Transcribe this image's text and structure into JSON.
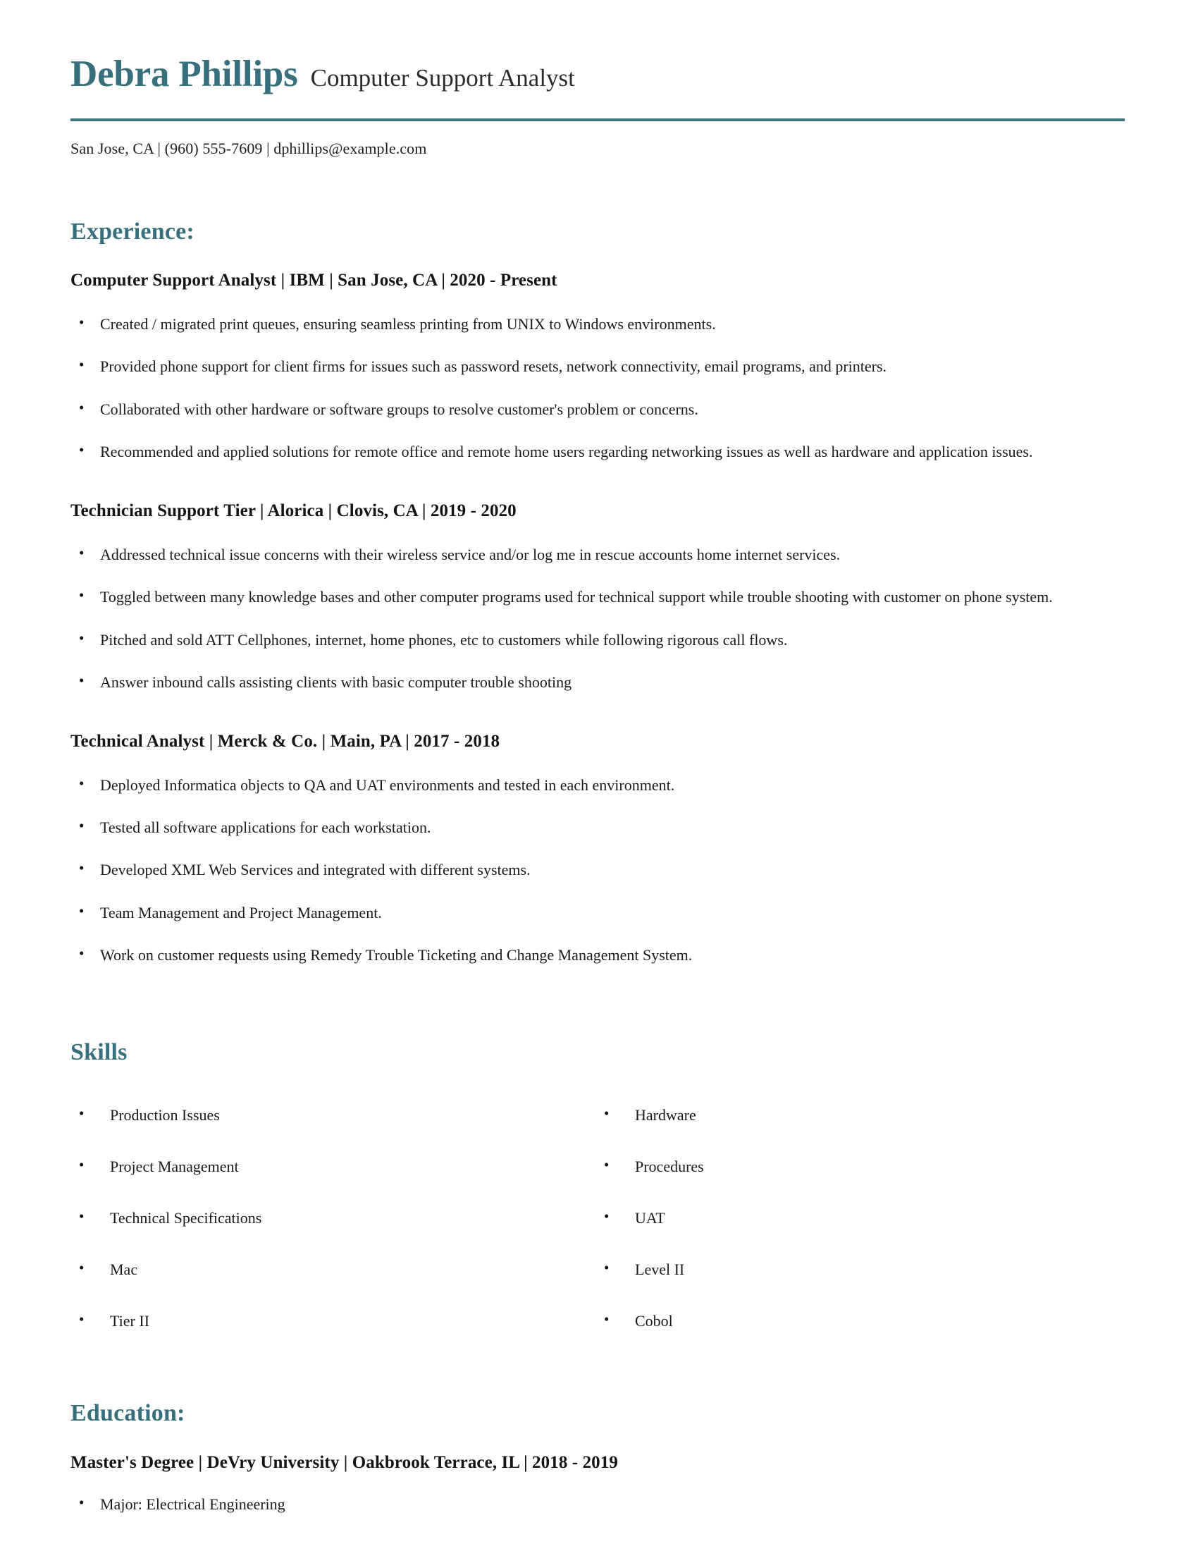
{
  "theme": {
    "accent_color": "#37707C",
    "rule_color": "#3D7480",
    "text_color": "#1B1B1B"
  },
  "header": {
    "name": "Debra Phillips",
    "job_title": "Computer Support Analyst",
    "contact": "San Jose, CA  |  (960) 555-7609  |  dphillips@example.com",
    "location": "San Jose, CA",
    "phone": "(960) 555-7609",
    "email": "dphillips@example.com"
  },
  "experience": {
    "heading": "Experience:",
    "entries": [
      {
        "heading": "Computer Support Analyst | IBM | San Jose, CA | 2020 - Present",
        "title": "Computer Support Analyst",
        "company": "IBM",
        "location": "San Jose, CA",
        "dates": "2020 - Present",
        "bullets": [
          "Created / migrated print queues, ensuring seamless printing from UNIX to Windows environments.",
          "Provided phone support for client firms for issues such as password resets, network connectivity, email programs, and printers.",
          "Collaborated with other hardware or software groups to resolve customer's problem or concerns.",
          "Recommended and applied solutions for remote office and remote home users regarding networking issues as well as hardware and application issues."
        ]
      },
      {
        "heading": "Technician Support Tier | Alorica | Clovis, CA | 2019 - 2020",
        "title": "Technician Support Tier",
        "company": "Alorica",
        "location": "Clovis, CA",
        "dates": "2019 - 2020",
        "bullets": [
          "Addressed technical issue concerns with their wireless service and/or log me in rescue accounts home internet services.",
          "Toggled between many knowledge bases and other computer programs used for technical support while trouble shooting with customer on phone system.",
          "Pitched and sold ATT Cellphones, internet, home phones, etc to customers while following rigorous call flows.",
          "Answer inbound calls assisting clients with basic computer trouble shooting"
        ]
      },
      {
        "heading": "Technical Analyst | Merck & Co. | Main, PA | 2017 - 2018",
        "title": "Technical Analyst",
        "company": "Merck & Co.",
        "location": "Main, PA",
        "dates": "2017 - 2018",
        "bullets": [
          "Deployed Informatica objects to QA and UAT environments and tested in each environment.",
          "Tested all software applications for each workstation.",
          "Developed XML Web Services and integrated with different systems.",
          "Team Management and Project Management.",
          "Work on customer requests using Remedy Trouble Ticketing and Change Management System."
        ]
      }
    ]
  },
  "skills": {
    "heading": "Skills",
    "column_left": [
      "Production Issues",
      "Project Management",
      "Technical Specifications",
      "Mac",
      "Tier II"
    ],
    "column_right": [
      "Hardware",
      "Procedures",
      "UAT",
      "Level II",
      "Cobol"
    ]
  },
  "education": {
    "heading": "Education:",
    "entries": [
      {
        "heading": "Master's Degree | DeVry University | Oakbrook Terrace, IL | 2018 - 2019",
        "degree": "Master's Degree",
        "school": "DeVry University",
        "location": "Oakbrook Terrace, IL",
        "dates": "2018 - 2019",
        "bullets": [
          "Major: Electrical Engineering"
        ]
      }
    ]
  }
}
